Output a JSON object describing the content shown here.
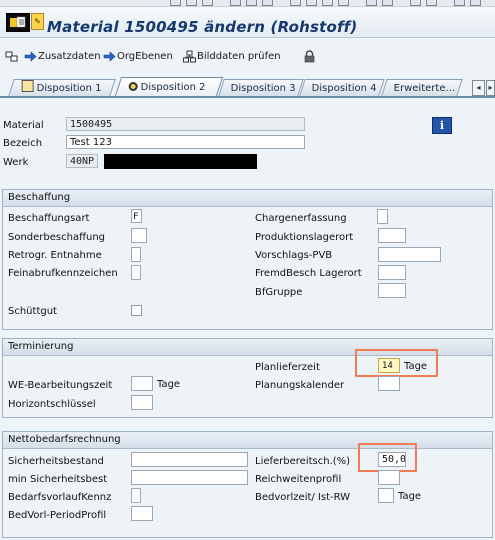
{
  "title": "Material 1500495 ändern (Rohstoff)",
  "toolbar": {
    "zusatzdaten": "Zusatzdaten",
    "orgebenen": "OrgEbenen",
    "bilddaten": "Bilddaten prüfen"
  },
  "tabs": [
    "Disposition 1",
    "Disposition 2",
    "Disposition 3",
    "Disposition 4",
    "Erweiterte..."
  ],
  "active_tab": "Disposition 2",
  "header": {
    "material_label": "Material",
    "material_value": "1500495",
    "bezeich_label": "Bezeich",
    "bezeich_value": "Test 123",
    "werk_label": "Werk",
    "werk_value": "40NP"
  },
  "beschaffung": {
    "title": "Beschaffung",
    "beschaffungsart_label": "Beschaffungsart",
    "beschaffungsart_value": "F",
    "sonderbeschaffung_label": "Sonderbeschaffung",
    "retrogr_label": "Retrogr. Entnahme",
    "feinabruf_label": "Feinabrufkennzeichen",
    "schuettgut_label": "Schüttgut",
    "charge_label": "Chargenerfassung",
    "produktionslagerort_label": "Produktionslagerort",
    "vorschlags_label": "Vorschlags-PVB",
    "fremdbesch_label": "FremdBesch Lagerort",
    "bfgruppe_label": "BfGruppe"
  },
  "terminierung": {
    "title": "Terminierung",
    "we_label": "WE-Bearbeitungszeit",
    "we_unit": "Tage",
    "horizont_label": "Horizontschlüssel",
    "planlieferzeit_label": "Planlieferzeit",
    "planlieferzeit_value": "14",
    "planlieferzeit_unit": "Tage",
    "planungskalender_label": "Planungskalender"
  },
  "netto": {
    "title": "Nettobedarfsrechnung",
    "sicherheitsbestand_label": "Sicherheitsbestand",
    "min_sicherheit_label": "min Sicherheitsbest",
    "bedarfsvorlauf_label": "BedarfsvorlaufKennz",
    "bedvorl_label": "BedVorl-PeriodProfil",
    "lieferbereit_label": "Lieferbereitsch.(%)",
    "lieferbereit_value": "50,0",
    "reichweiten_label": "Reichweitenprofil",
    "bedvorzeit_label": "Bedvorlzeit/ Ist-RW",
    "bedvorzeit_unit": "Tage"
  },
  "colors": {
    "highlight_box": "#f07b54",
    "title_text": "#163a6e",
    "info_button": "#2356a8"
  }
}
